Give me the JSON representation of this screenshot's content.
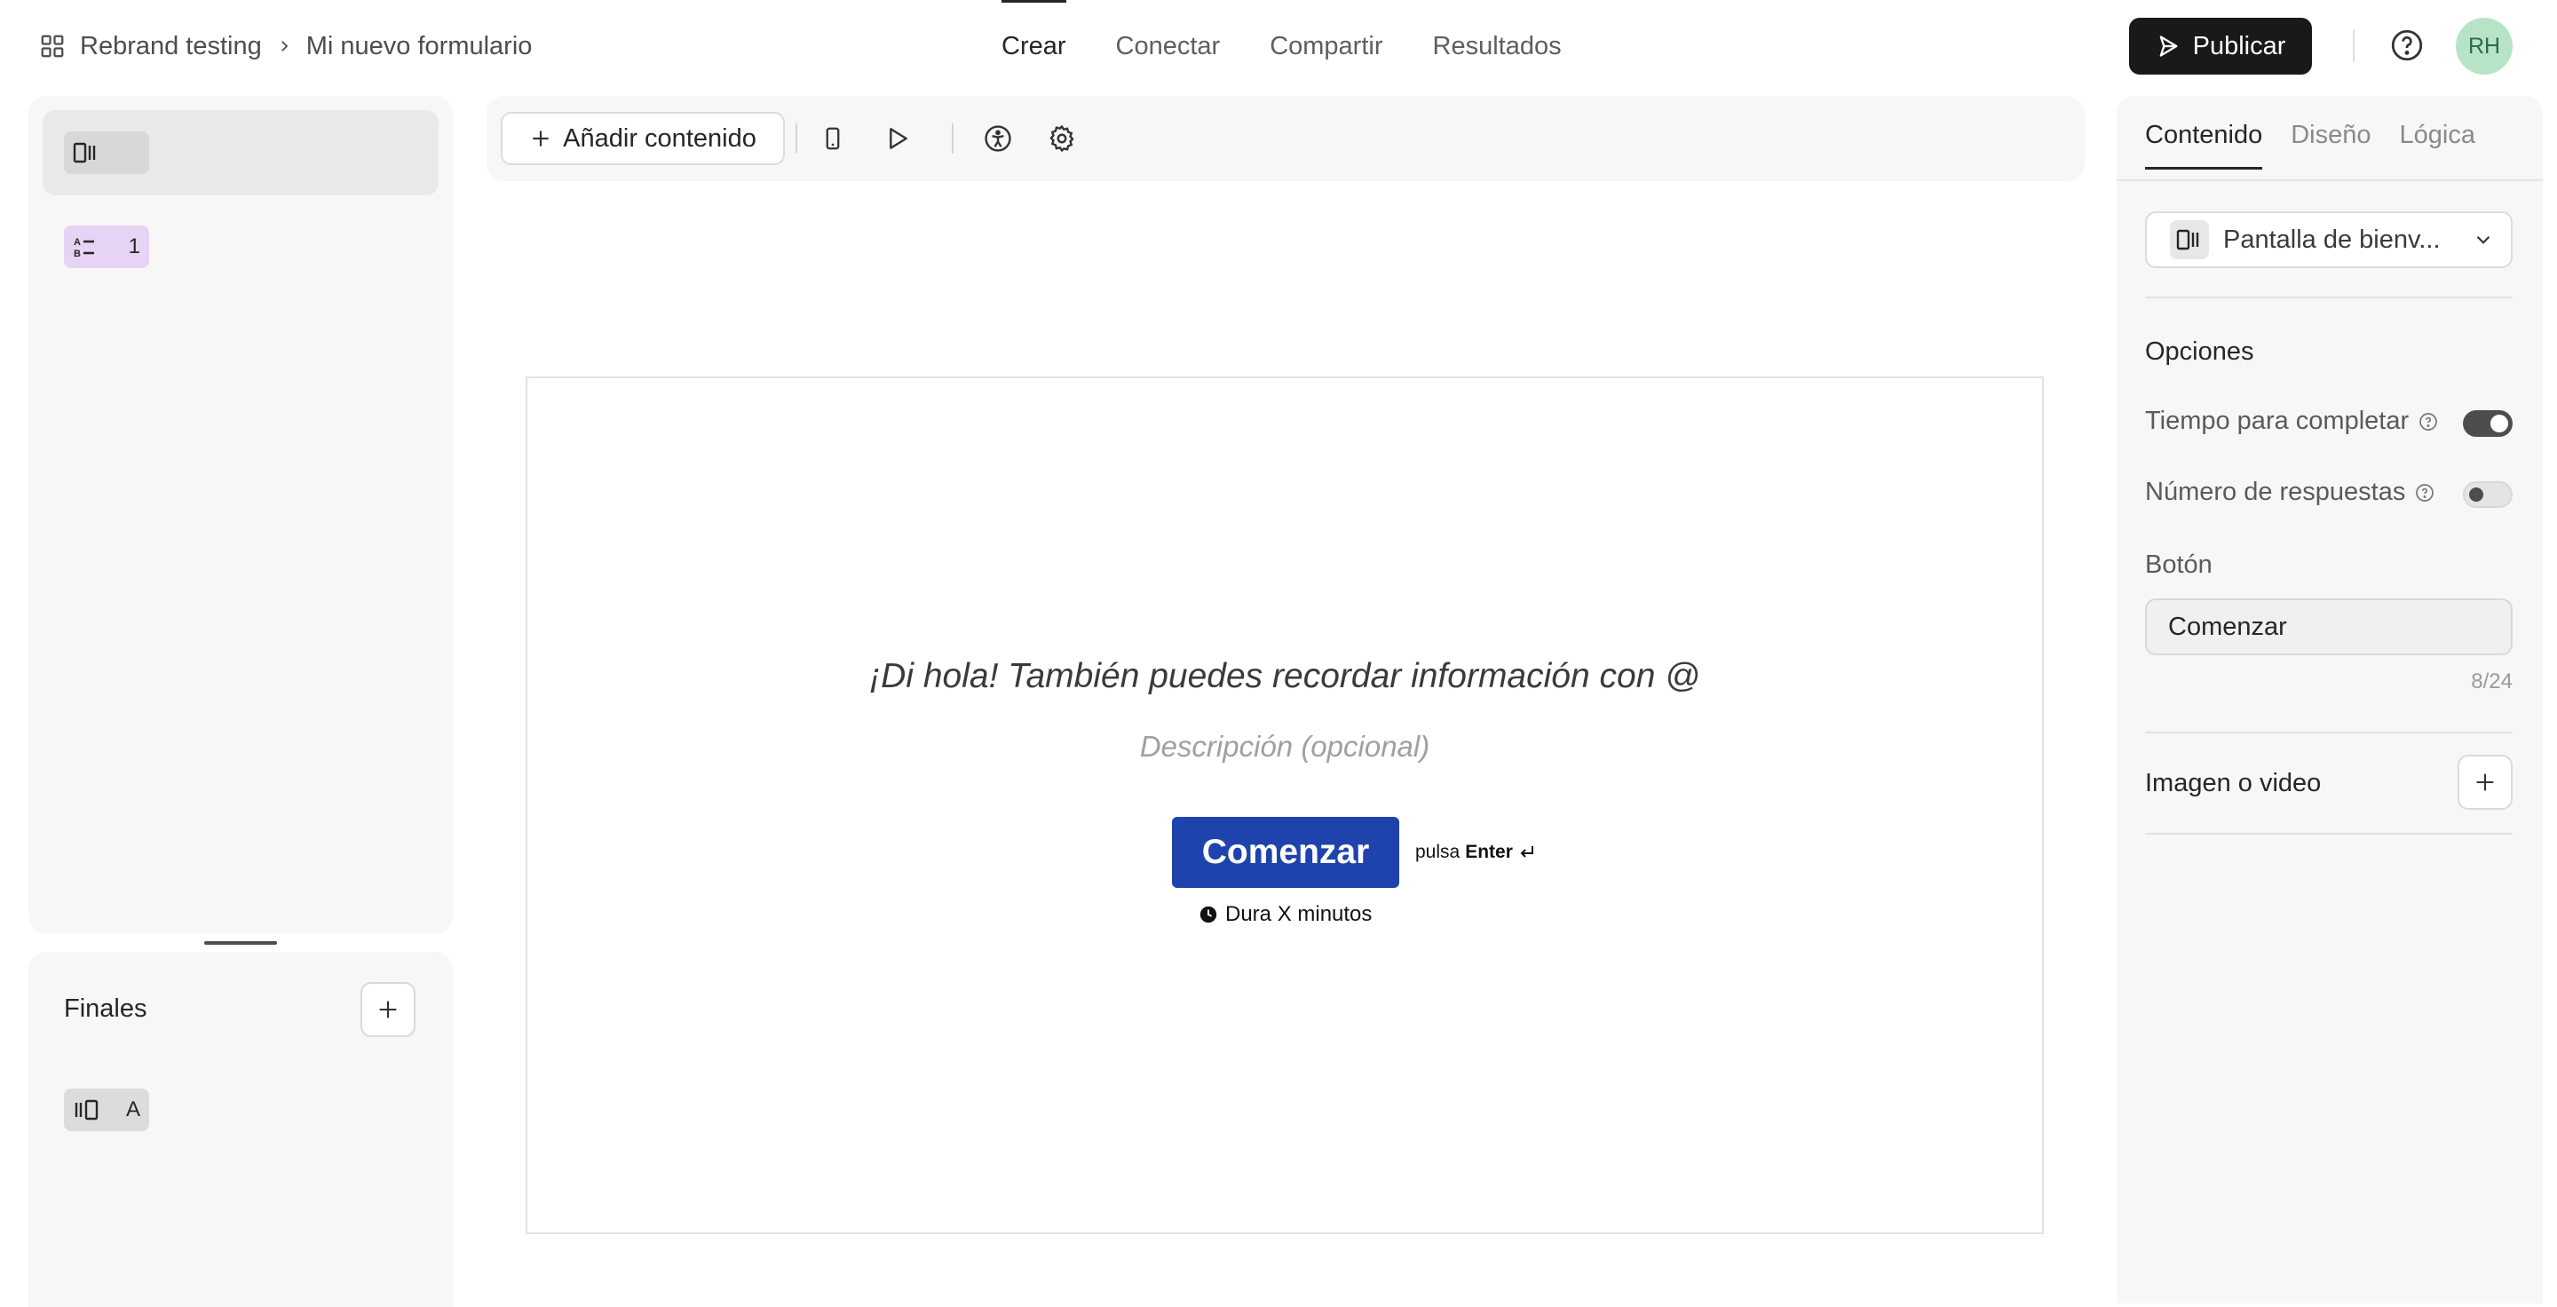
{
  "breadcrumb": {
    "workspace": "Rebrand testing",
    "form": "Mi nuevo formulario"
  },
  "nav": {
    "tabs": [
      {
        "label": "Crear"
      },
      {
        "label": "Conectar"
      },
      {
        "label": "Compartir"
      },
      {
        "label": "Resultados"
      }
    ],
    "active": "Crear"
  },
  "header": {
    "publish_label": "Publicar",
    "avatar_initials": "RH"
  },
  "left_panel": {
    "question_number": "1",
    "endings_title": "Finales",
    "ending_label": "A"
  },
  "toolbar": {
    "add_content_label": "Añadir contenido"
  },
  "canvas": {
    "title": "¡Di hola! También puedes recordar información con @",
    "description_placeholder": "Descripción (opcional)",
    "button_label": "Comenzar",
    "press_text": "pulsa",
    "press_key": "Enter",
    "duration_text": "Dura X minutos",
    "button_color": "#1f43ad"
  },
  "right_panel": {
    "tabs": [
      {
        "label": "Contenido"
      },
      {
        "label": "Diseño"
      },
      {
        "label": "Lógica"
      }
    ],
    "active_tab": "Contenido",
    "block_type": "Pantalla de bienv...",
    "options_title": "Opciones",
    "options": [
      {
        "label": "Tiempo para completar",
        "enabled": true
      },
      {
        "label": "Número de respuestas",
        "enabled": false
      }
    ],
    "button_section_label": "Botón",
    "button_value": "Comenzar",
    "button_counter": "8/24",
    "media_label": "Imagen o video"
  }
}
